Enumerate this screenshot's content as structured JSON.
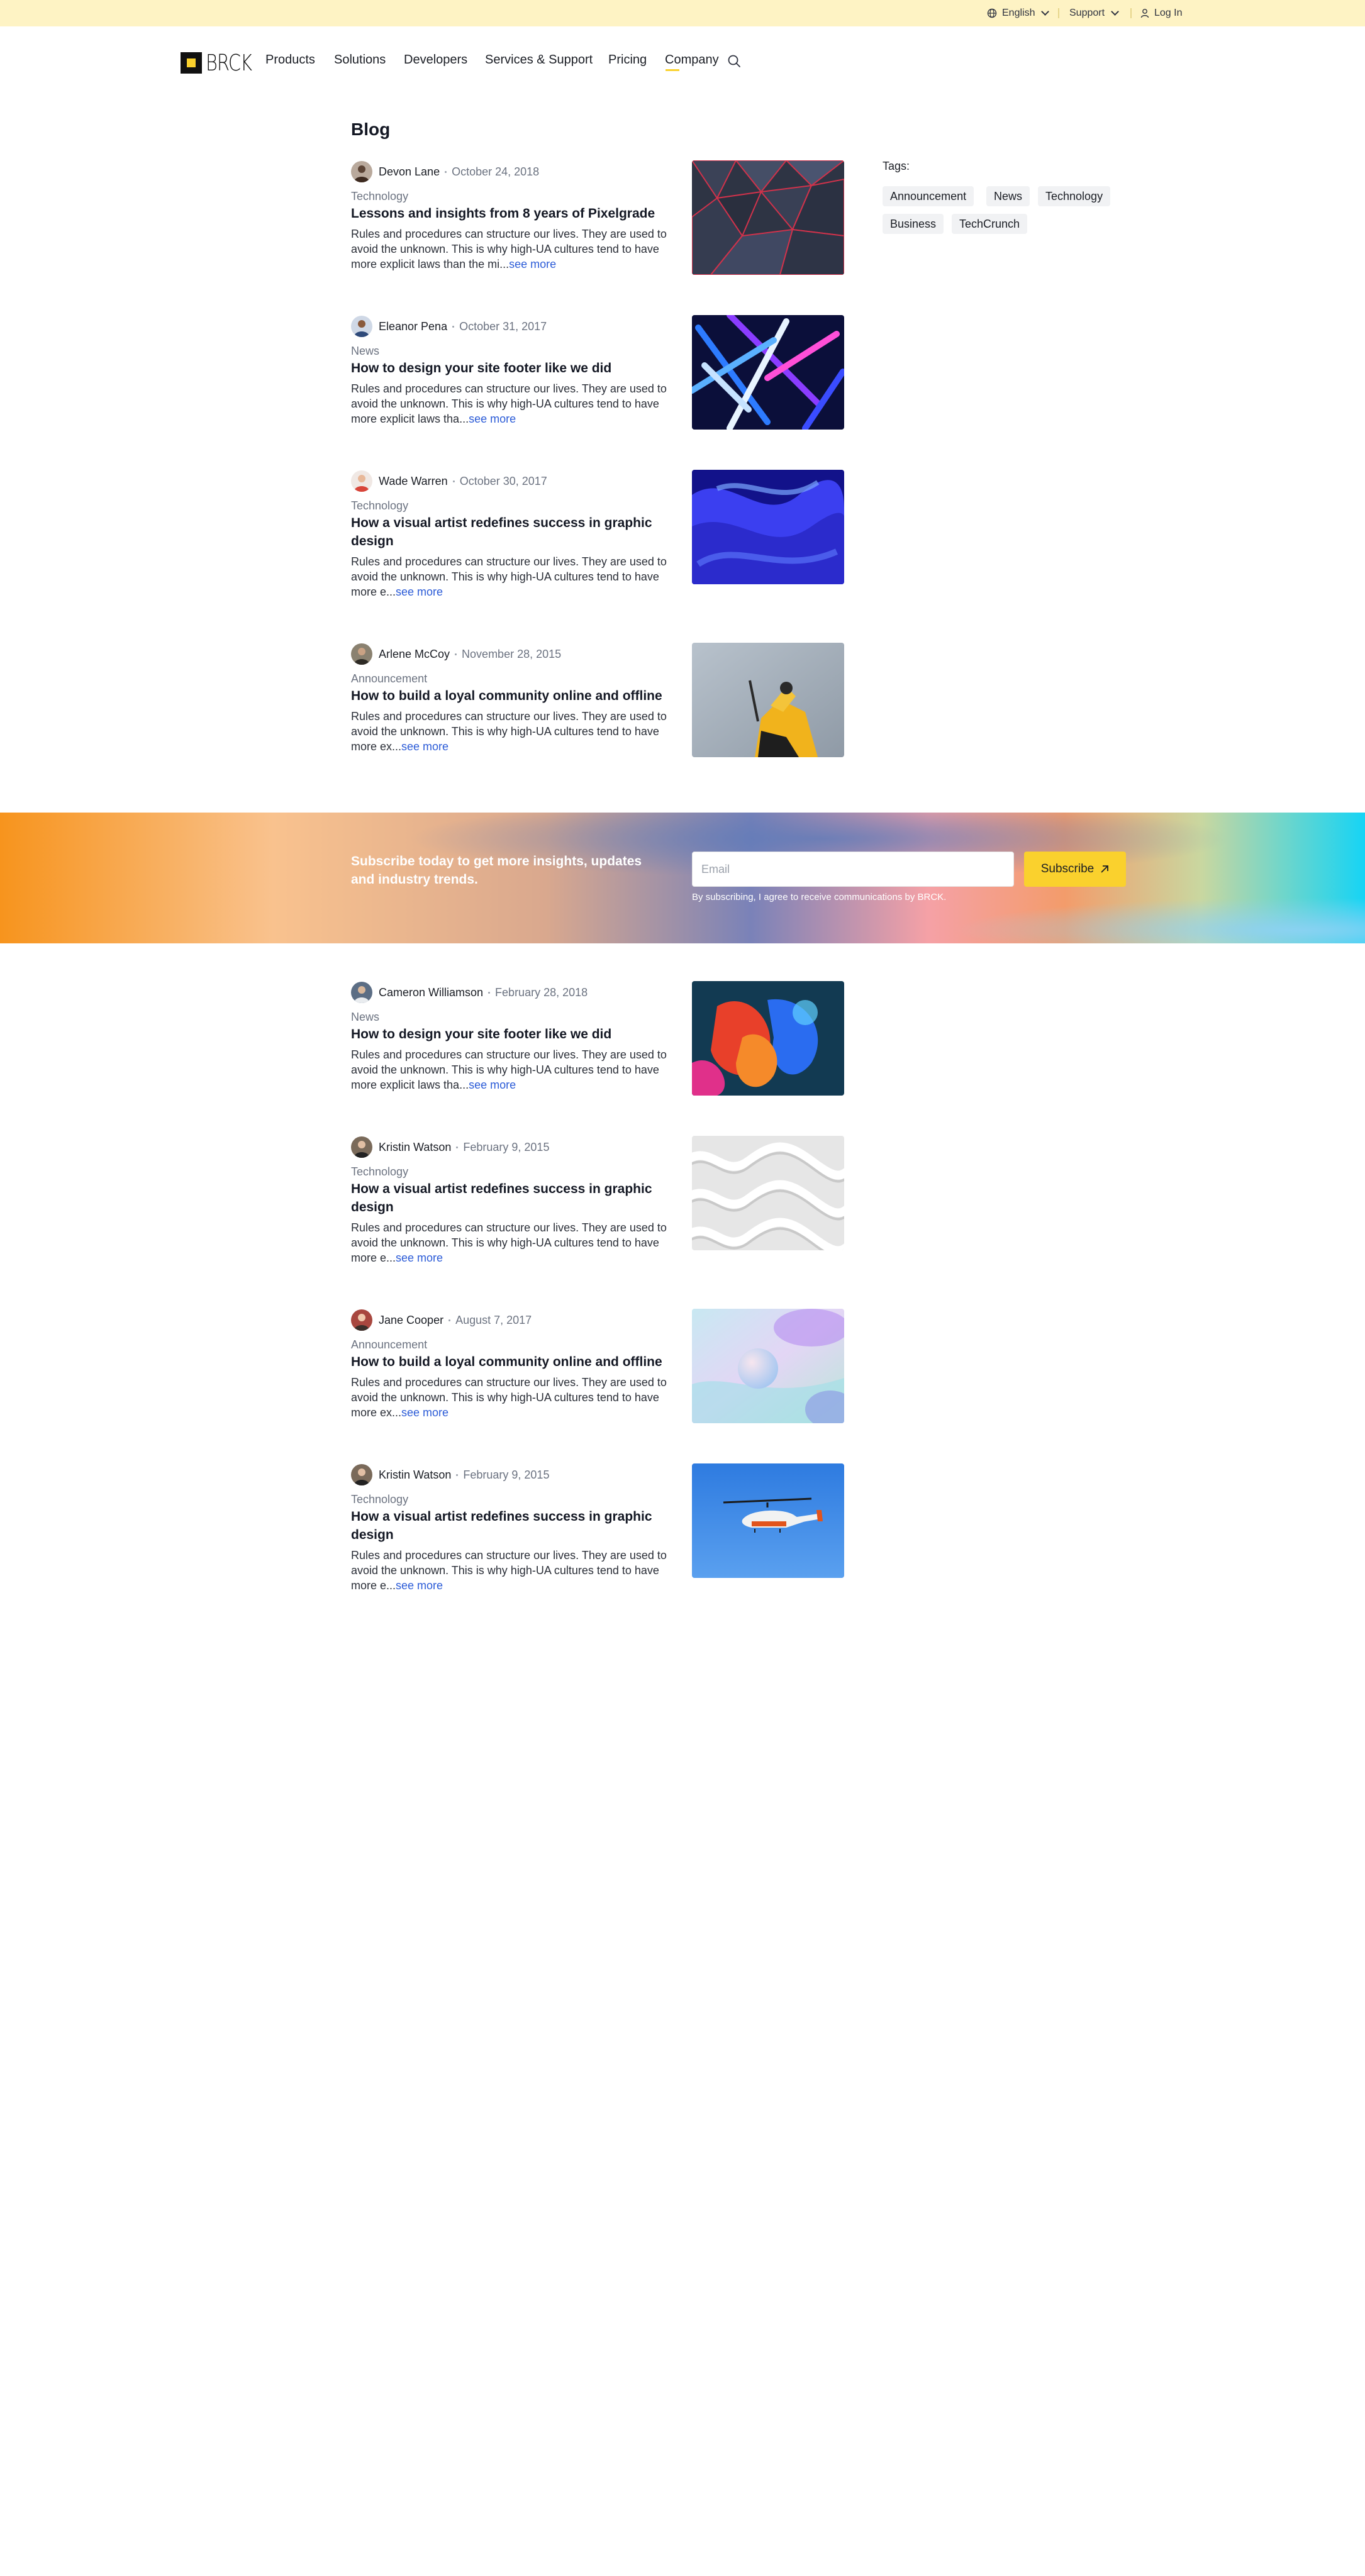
{
  "topbar": {
    "language": "English",
    "support": "Support",
    "login": "Log In"
  },
  "brand": {
    "name": "BRCK"
  },
  "nav": {
    "items": [
      "Products",
      "Solutions",
      "Developers",
      "Services & Support",
      "Pricing",
      "Company"
    ],
    "active": "Company"
  },
  "blog": {
    "title": "Blog",
    "more_label": "see more",
    "posts": [
      {
        "author": "Devon Lane",
        "date": "October 24, 2018",
        "category": "Technology",
        "title": "Lessons and insights from 8 years of Pixelgrade",
        "excerpt": "Rules and procedures can structure our lives. They are used to avoid the unknown. This is why high-UA cultures tend to have more explicit laws than the mi..."
      },
      {
        "author": "Eleanor Pena",
        "date": "October 31, 2017",
        "category": "News",
        "title": "How to design your site footer like we did",
        "excerpt": "Rules and procedures can structure our lives. They are used to avoid the unknown. This is why high-UA cultures tend to have more explicit laws tha..."
      },
      {
        "author": "Wade Warren",
        "date": "October 30, 2017",
        "category": "Technology",
        "title": "How a visual artist redefines success in graphic design",
        "excerpt": "Rules and procedures can structure our lives. They are used to avoid the unknown. This is why high-UA cultures tend to have more e..."
      },
      {
        "author": "Arlene McCoy",
        "date": "November 28, 2015",
        "category": "Announcement",
        "title": "How to build a loyal community online and offline",
        "excerpt": "Rules and procedures can structure our lives. They are used to avoid the unknown. This is why high-UA cultures tend to have more ex..."
      },
      {
        "author": "Cameron Williamson",
        "date": "February 28, 2018",
        "category": "News",
        "title": "How to design your site footer like we did",
        "excerpt": "Rules and procedures can structure our lives. They are used to avoid the unknown. This is why high-UA cultures tend to have more explicit laws tha..."
      },
      {
        "author": "Kristin Watson",
        "date": "February 9, 2015",
        "category": "Technology",
        "title": "How a visual artist redefines success in graphic design",
        "excerpt": "Rules and procedures can structure our lives. They are used to avoid the unknown. This is why high-UA cultures tend to have more e..."
      },
      {
        "author": "Jane Cooper",
        "date": "August 7, 2017",
        "category": "Announcement",
        "title": "How to build a loyal community online and offline",
        "excerpt": "Rules and procedures can structure our lives. They are used to avoid the unknown. This is why high-UA cultures tend to have more ex..."
      },
      {
        "author": "Kristin Watson",
        "date": "February 9, 2015",
        "category": "Technology",
        "title": "How a visual artist redefines success in graphic design",
        "excerpt": "Rules and procedures can structure our lives. They are used to avoid the unknown. This is why high-UA cultures tend to have more e..."
      }
    ]
  },
  "tags": {
    "label": "Tags:",
    "items": [
      "Announcement",
      "News",
      "Technology",
      "Business",
      "TechCrunch"
    ]
  },
  "subscribe": {
    "heading": "Subscribe today to get more insights, updates and industry trends.",
    "email_placeholder": "Email",
    "button": "Subscribe",
    "disclaimer": "By subscribing, I agree to receive communications by BRCK."
  },
  "colors": {
    "accent": "#fad12d",
    "topbar_bg": "#fef3c4",
    "link": "#2b5bd7",
    "text": "#1a1d24",
    "muted": "#6b7280"
  },
  "icons": {
    "language": "globe-icon",
    "support_menu": "chevron-down-icon",
    "login": "user-icon",
    "search": "search-icon",
    "subscribe": "arrow-up-right-icon"
  }
}
